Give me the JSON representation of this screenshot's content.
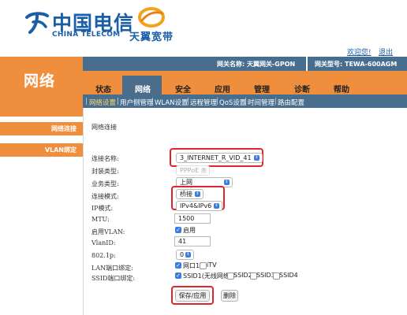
{
  "header": {
    "brand_cn": "中国电信",
    "brand_en": "CHINA TELECOM",
    "brand_tianyi": "天翼宽带",
    "welcome": "欢迎您!",
    "logout": "退出"
  },
  "gateway": {
    "name": "网关名称:  天翼网关-GPON",
    "model": "网关型号:  TEWA-600AGM"
  },
  "section_heading": "网络",
  "tabs": [
    "状态",
    "网络",
    "安全",
    "应用",
    "管理",
    "诊断",
    "帮助"
  ],
  "active_tab": "网络",
  "subtabs": [
    "网络设置",
    "用户侧管理",
    "WLAN设置",
    "远程管理",
    "QoS设置",
    "时间管理",
    "路由配置"
  ],
  "sidebar": [
    "网络连接",
    "VLAN绑定"
  ],
  "content": {
    "title": "网络连接",
    "labels": {
      "connection_name": "连接名称:",
      "wrap_type": "封装类型:",
      "service_type": "业务类型:",
      "connection_mode": "连接模式:",
      "ip_mode": "IP模式:",
      "mtu": "MTU:",
      "enable_vlan": "启用VLAN:",
      "vlan_id": "VlanID:",
      "p8021": "802.1p:",
      "lan_binding": "LAN端口绑定:",
      "ssid_binding": "SSID端口绑定:"
    },
    "values": {
      "connection_name": "3_INTERNET_R_VID_41",
      "wrap_type": "PPPoE",
      "service_type": "上网",
      "connection_mode": "桥接",
      "ip_mode": "IPv4&IPv6",
      "mtu": "1500",
      "enable_vlan": "启用",
      "vlan_id": "41",
      "p8021": "0"
    },
    "lan_ports": [
      {
        "label": "网口1",
        "checked": true
      },
      {
        "label": "iTV",
        "checked": false
      }
    ],
    "ssid_ports": [
      {
        "label": "SSID1(无线网络)",
        "checked": true
      },
      {
        "label": "SSID2",
        "checked": false
      },
      {
        "label": "SSID3",
        "checked": false
      },
      {
        "label": "SSID4",
        "checked": false
      }
    ],
    "buttons": {
      "save": "保存/应用",
      "delete": "删除"
    }
  },
  "colors": {
    "orange": "#ef8e3c",
    "bar_blue": "#486e8f",
    "brand_blue": "#1a5ea8",
    "highlight_red": "#e0232e"
  }
}
